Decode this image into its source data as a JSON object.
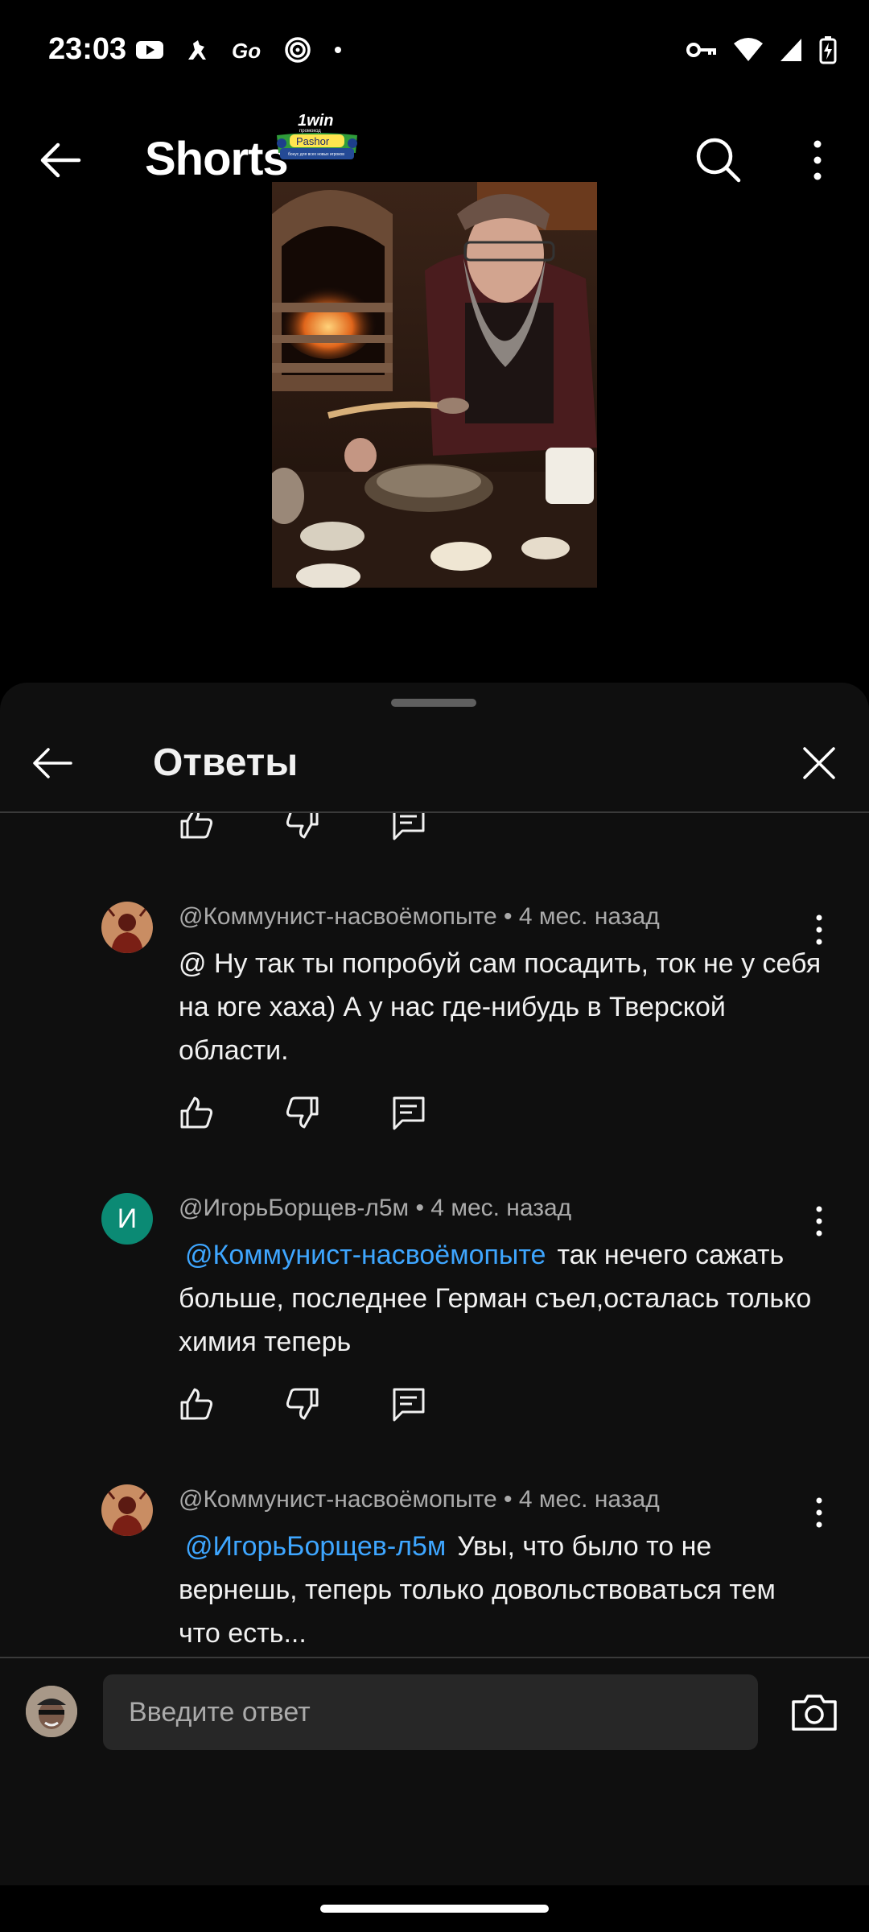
{
  "status_bar": {
    "time": "23:03",
    "left_icons": [
      "youtube-icon",
      "kangaroo-icon",
      "go-icon",
      "spiral-icon",
      "dot-icon"
    ],
    "right_icons": [
      "vpn-key-icon",
      "wifi-icon",
      "signal-icon",
      "battery-charging-icon"
    ]
  },
  "header": {
    "title": "Shorts",
    "promo": {
      "brand": "1win",
      "line1": "промокод",
      "code": "Pashor",
      "line2": "бонус для всех новых игроков"
    }
  },
  "replies_panel": {
    "title": "Ответы",
    "comments": [
      {
        "author": "@Коммунист-насвоёмопыте",
        "time": "4 мес. назад",
        "meta": "@Коммунист-насвоёмопыте • 4 мес. назад",
        "mention": "",
        "text": "@ Ну так ты попробуй сам посадить, ток не у себя на юге хаха) А у нас где-нибудь в Тверской области.",
        "avatar": "image"
      },
      {
        "author": "@ИгорьБорщев-л5м",
        "time": "4 мес. назад",
        "meta": "@ИгорьБорщев-л5м • 4 мес. назад",
        "mention": "@Коммунист-насвоёмопыте",
        "text": "так нечего сажать больше, последнее Герман съел,осталась только химия теперь",
        "avatar_letter": "И",
        "avatar_color": "#0b8a74"
      },
      {
        "author": "@Коммунист-насвоёмопыте",
        "time": "4 мес. назад",
        "meta": "@Коммунист-насвоёмопыте • 4 мес. назад",
        "mention": "@ИгорьБорщев-л5м",
        "text": "Увы, что было то не вернешь, теперь только довольствоваться тем что есть...",
        "avatar": "image"
      }
    ]
  },
  "composer": {
    "placeholder": "Введите ответ"
  },
  "colors": {
    "mention": "#3ea6ff",
    "sheet_bg": "#0f0f0f",
    "meta_text": "#aaaaaa"
  }
}
